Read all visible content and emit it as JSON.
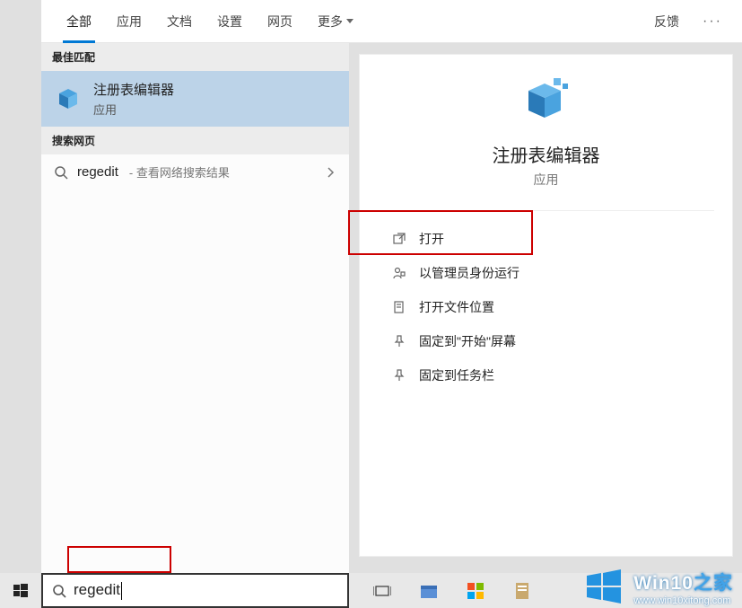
{
  "tabs": {
    "items": [
      "全部",
      "应用",
      "文档",
      "设置",
      "网页",
      "更多"
    ],
    "active_index": 0,
    "feedback": "反馈"
  },
  "left": {
    "best_match_header": "最佳匹配",
    "best_match": {
      "title": "注册表编辑器",
      "subtitle": "应用"
    },
    "search_web_header": "搜索网页",
    "web": {
      "term": "regedit",
      "desc": "- 查看网络搜索结果"
    }
  },
  "detail": {
    "title": "注册表编辑器",
    "subtitle": "应用",
    "actions": [
      "打开",
      "以管理员身份运行",
      "打开文件位置",
      "固定到\"开始\"屏幕",
      "固定到任务栏"
    ]
  },
  "search": {
    "query": "regedit"
  },
  "watermark": {
    "brand_a": "Win10",
    "brand_b": "之家",
    "url": "www.win10xitong.com"
  }
}
